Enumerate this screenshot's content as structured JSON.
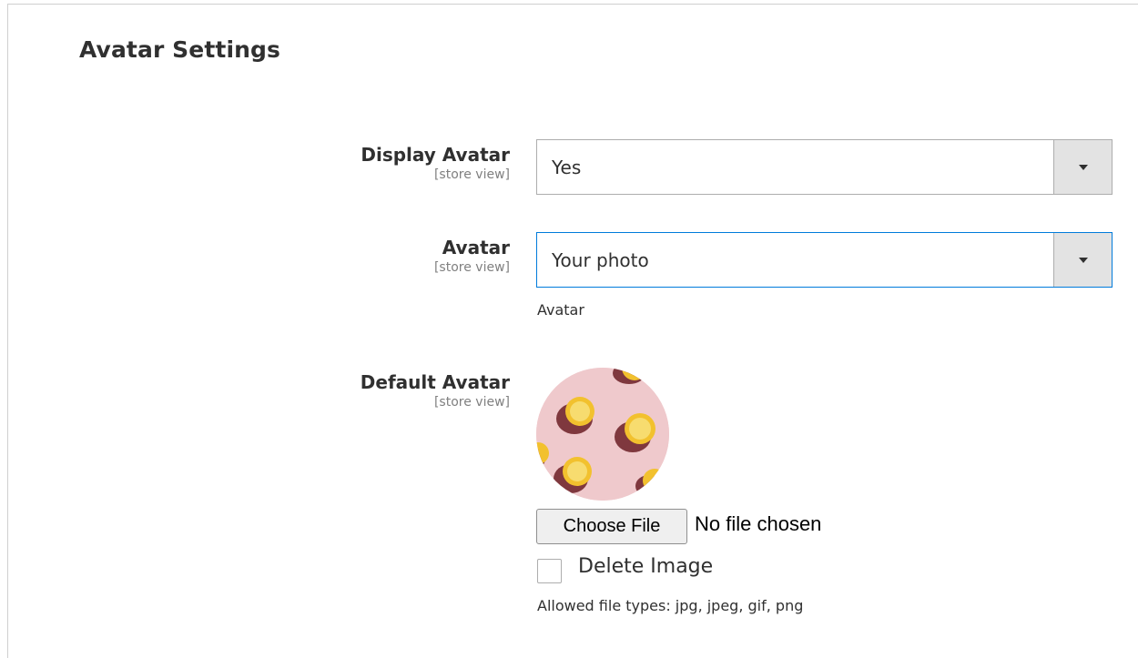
{
  "section": {
    "title": "Avatar Settings"
  },
  "fields": {
    "display_avatar": {
      "label": "Display Avatar",
      "scope": "[store view]",
      "value": "Yes"
    },
    "avatar": {
      "label": "Avatar",
      "scope": "[store view]",
      "value": "Your photo",
      "note": "Avatar"
    },
    "default_avatar": {
      "label": "Default Avatar",
      "scope": "[store view]",
      "file_button": "Choose File",
      "file_status": "No file chosen",
      "delete_label": "Delete Image",
      "delete_checked": false,
      "allowed_types": "Allowed file types: jpg, jpeg, gif, png"
    }
  },
  "icons": {
    "select_arrow": "chevron-down-icon"
  },
  "colors": {
    "focus_border": "#007bdb",
    "avatar_bg": "#efc9cc",
    "lemon": "#f2c12e"
  }
}
